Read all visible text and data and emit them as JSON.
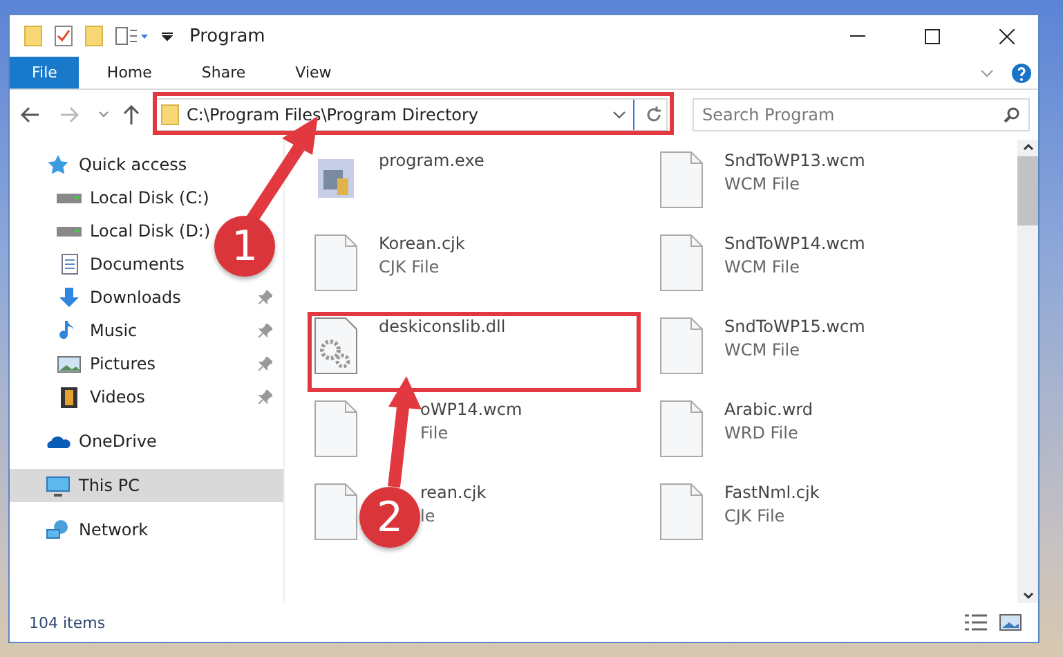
{
  "window": {
    "title": "Program"
  },
  "ribbon_tabs": [
    {
      "label": "File",
      "selected": true
    },
    {
      "label": "Home",
      "selected": false
    },
    {
      "label": "Share",
      "selected": false
    },
    {
      "label": "View",
      "selected": false
    }
  ],
  "address": {
    "path": "C:\\Program Files\\Program Directory"
  },
  "search": {
    "placeholder": "Search Program"
  },
  "sidebar": {
    "items": [
      {
        "label": "Quick access",
        "kind": "star",
        "pinned": false,
        "selected": false,
        "children": [
          {
            "label": "Local Disk (C:)",
            "kind": "drive",
            "pinned": false,
            "selected": false
          },
          {
            "label": "Local Disk (D:)",
            "kind": "drive",
            "pinned": false,
            "selected": false
          },
          {
            "label": "Documents",
            "kind": "document",
            "pinned": false,
            "selected": false
          },
          {
            "label": "Downloads",
            "kind": "download",
            "pinned": true,
            "selected": false
          },
          {
            "label": "Music",
            "kind": "music",
            "pinned": true,
            "selected": false
          },
          {
            "label": "Pictures",
            "kind": "pictures",
            "pinned": true,
            "selected": false
          },
          {
            "label": "Videos",
            "kind": "videos",
            "pinned": true,
            "selected": false
          }
        ]
      },
      {
        "label": "OneDrive",
        "kind": "cloud",
        "pinned": false,
        "selected": false
      },
      {
        "label": "This PC",
        "kind": "pc",
        "pinned": false,
        "selected": true
      },
      {
        "label": "Network",
        "kind": "network",
        "pinned": false,
        "selected": false
      }
    ]
  },
  "files": [
    {
      "name": "program.exe",
      "kind": "exe",
      "covered": false,
      "highlighted": false
    },
    {
      "name": "SndToWP13.wcm",
      "type": "WCM File",
      "kind": "doc",
      "covered": false,
      "highlighted": false
    },
    {
      "name": "Korean.cjk",
      "type": "CJK File",
      "kind": "doc",
      "covered": false,
      "highlighted": false
    },
    {
      "name": "SndToWP14.wcm",
      "type": "WCM File",
      "kind": "doc",
      "covered": false,
      "highlighted": false
    },
    {
      "name": "deskiconslib.dll",
      "kind": "dll",
      "covered": false,
      "highlighted": true
    },
    {
      "name": "SndToWP15.wcm",
      "type": "WCM File",
      "kind": "doc",
      "covered": false,
      "highlighted": false
    },
    {
      "name": "oWP14.wcm",
      "type": "File",
      "kind": "doc",
      "covered": true,
      "highlighted": false
    },
    {
      "name": "Arabic.wrd",
      "type": "WRD File",
      "kind": "doc",
      "covered": false,
      "highlighted": false
    },
    {
      "name": "rean.cjk",
      "type": "le",
      "kind": "doc",
      "covered": true,
      "highlighted": false
    },
    {
      "name": "FastNml.cjk",
      "type": "CJK File",
      "kind": "doc",
      "covered": false,
      "highlighted": false
    }
  ],
  "status_bar": {
    "count": "104 items"
  },
  "annotations": [
    {
      "number": "1"
    },
    {
      "number": "2"
    }
  ]
}
